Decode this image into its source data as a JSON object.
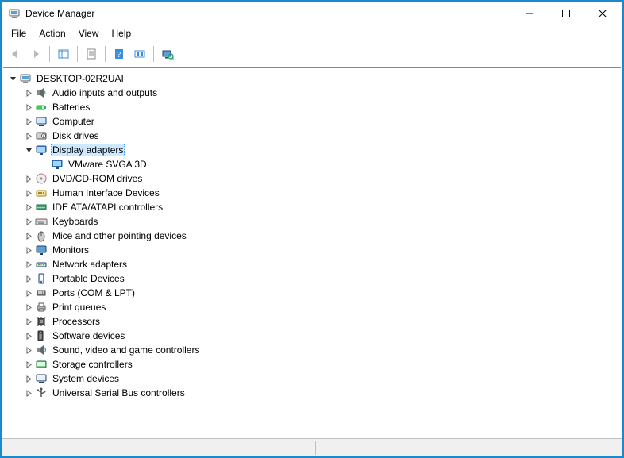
{
  "window": {
    "title": "Device Manager"
  },
  "menu": {
    "file": "File",
    "action": "Action",
    "view": "View",
    "help": "Help"
  },
  "tree": {
    "root": {
      "label": "DESKTOP-02R2UAI",
      "expanded": true,
      "icon": "computer-root",
      "children": [
        {
          "label": "Audio inputs and outputs",
          "icon": "audio",
          "collapsed": true
        },
        {
          "label": "Batteries",
          "icon": "battery",
          "collapsed": true
        },
        {
          "label": "Computer",
          "icon": "computer",
          "collapsed": true
        },
        {
          "label": "Disk drives",
          "icon": "disk",
          "collapsed": true
        },
        {
          "label": "Display adapters",
          "icon": "display",
          "collapsed": false,
          "selected": true,
          "children": [
            {
              "label": "VMware SVGA 3D",
              "icon": "display",
              "leaf": true
            }
          ]
        },
        {
          "label": "DVD/CD-ROM drives",
          "icon": "optical",
          "collapsed": true
        },
        {
          "label": "Human Interface Devices",
          "icon": "hid",
          "collapsed": true
        },
        {
          "label": "IDE ATA/ATAPI controllers",
          "icon": "ide",
          "collapsed": true
        },
        {
          "label": "Keyboards",
          "icon": "keyboard",
          "collapsed": true
        },
        {
          "label": "Mice and other pointing devices",
          "icon": "mouse",
          "collapsed": true
        },
        {
          "label": "Monitors",
          "icon": "monitor",
          "collapsed": true
        },
        {
          "label": "Network adapters",
          "icon": "network",
          "collapsed": true
        },
        {
          "label": "Portable Devices",
          "icon": "portable",
          "collapsed": true
        },
        {
          "label": "Ports (COM & LPT)",
          "icon": "port",
          "collapsed": true
        },
        {
          "label": "Print queues",
          "icon": "printer",
          "collapsed": true
        },
        {
          "label": "Processors",
          "icon": "cpu",
          "collapsed": true
        },
        {
          "label": "Software devices",
          "icon": "software",
          "collapsed": true
        },
        {
          "label": "Sound, video and game controllers",
          "icon": "sound",
          "collapsed": true
        },
        {
          "label": "Storage controllers",
          "icon": "storage",
          "collapsed": true
        },
        {
          "label": "System devices",
          "icon": "system",
          "collapsed": true
        },
        {
          "label": "Universal Serial Bus controllers",
          "icon": "usb",
          "collapsed": true
        }
      ]
    }
  }
}
